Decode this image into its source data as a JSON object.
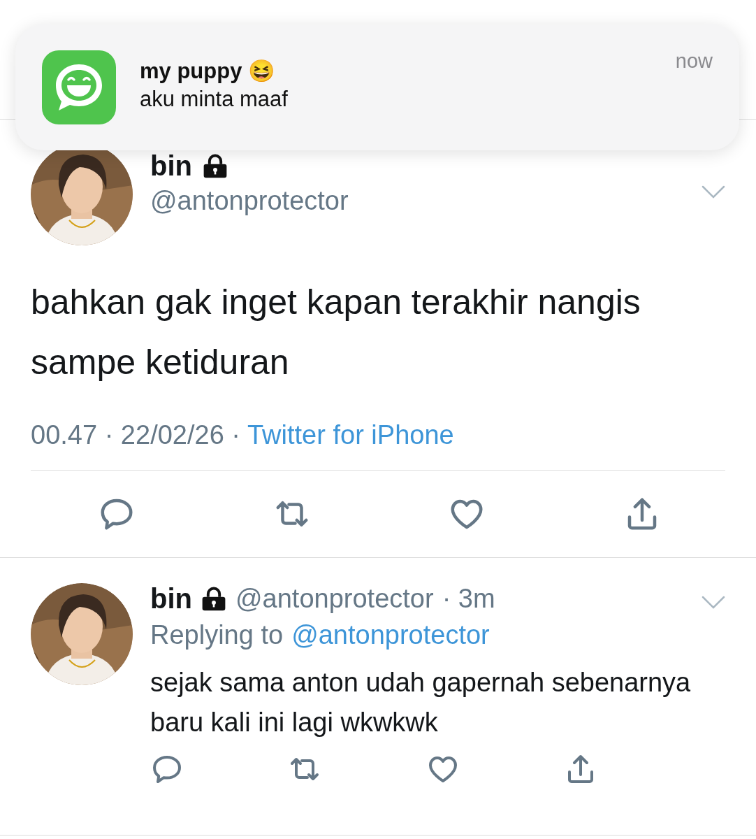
{
  "notification": {
    "title": "my puppy 😆",
    "message": "aku minta maaf",
    "time": "now"
  },
  "tweet": {
    "name": "bin",
    "protected": true,
    "handle": "@antonprotector",
    "text": "bahkan gak inget kapan terakhir nangis sampe ketiduran",
    "meta": "00.47 · 22/02/26 ·",
    "source": "Twitter for iPhone",
    "actions": [
      {
        "kind": "reply"
      },
      {
        "kind": "retweet"
      },
      {
        "kind": "like"
      },
      {
        "kind": "share"
      }
    ]
  },
  "reply": {
    "name": "bin",
    "protected": true,
    "handle": "@antonprotector",
    "time": "· 3m",
    "replying_label": "Replying to",
    "replying_handle": "@antonprotector",
    "text": "sejak sama anton udah gapernah sebenarnya baru kali ini lagi wkwkwk",
    "actions": [
      {
        "kind": "reply"
      },
      {
        "kind": "retweet"
      },
      {
        "kind": "like"
      },
      {
        "kind": "share"
      }
    ]
  }
}
